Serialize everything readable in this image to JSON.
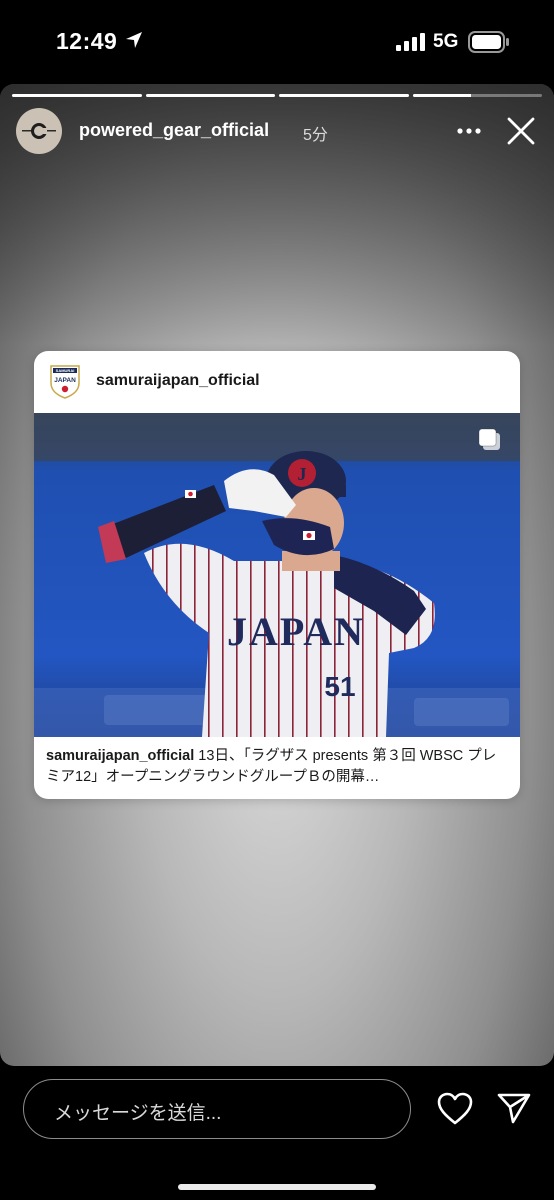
{
  "status_bar": {
    "time": "12:49",
    "network": "5G"
  },
  "story": {
    "progress_segments": [
      1,
      1,
      1,
      0.45
    ],
    "username": "powered_gear_official",
    "time_ago": "5分"
  },
  "post": {
    "username": "samuraijapan_official",
    "caption_user": "samuraijapan_official",
    "caption_text": " 13日、「ラグザス presents 第３回 WBSC プレミア12」オープニングラウンドグループＢの開幕…",
    "jersey_text": "JAPAN",
    "jersey_number": "51",
    "helmet_letter": "J",
    "logo_text_1": "SAMURAI",
    "logo_text_2": "JAPAN",
    "avatar_logo_text": "POWER C GEAR"
  },
  "message": {
    "placeholder": "メッセージを送信..."
  },
  "colors": {
    "story_bg": "#b8b8b8",
    "card_bg": "#ffffff",
    "bottom_bg": "#000000"
  },
  "icons": [
    "location-arrow-icon",
    "signal-icon",
    "battery-icon",
    "more-icon",
    "close-icon",
    "carousel-icon",
    "heart-icon",
    "send-icon"
  ]
}
